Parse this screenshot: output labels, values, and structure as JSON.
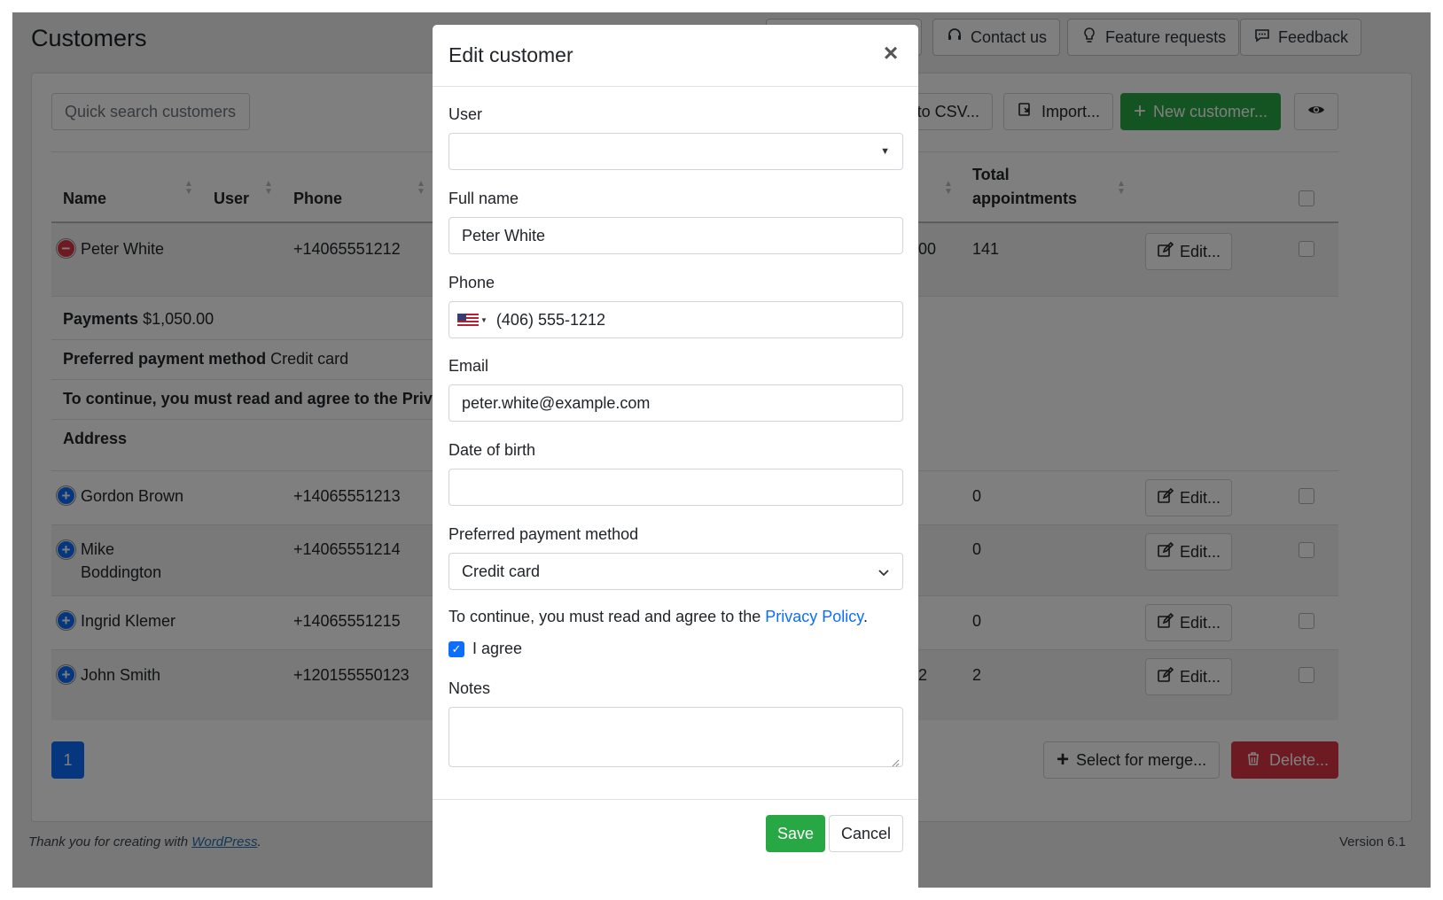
{
  "page": {
    "title": "Customers"
  },
  "top_buttons": {
    "contact": "Contact us",
    "feature": "Feature requests",
    "feedback": "Feedback"
  },
  "toolbar": {
    "search_placeholder": "Quick search customers",
    "export": "to CSV...",
    "import": "Import...",
    "new_customer": "New customer..."
  },
  "table": {
    "headers": {
      "name": "Name",
      "user": "User",
      "phone": "Phone",
      "total_line1": "Total",
      "total_line2": "appointments"
    },
    "rows": [
      {
        "name": "Peter White",
        "phone": "+14065551212",
        "partial": "00",
        "total": "141",
        "edit": "Edit...",
        "expanded": true
      },
      {
        "name": "Gordon Brown",
        "phone": "+14065551213",
        "partial": "",
        "total": "0",
        "edit": "Edit..."
      },
      {
        "name_line1": "Mike",
        "name_line2": "Boddington",
        "phone": "+14065551214",
        "partial": "",
        "total": "0",
        "edit": "Edit..."
      },
      {
        "name": "Ingrid Klemer",
        "phone": "+14065551215",
        "partial": "",
        "total": "0",
        "edit": "Edit..."
      },
      {
        "name": "John Smith",
        "phone": "+120155550123",
        "partial": "2",
        "total": "2",
        "edit": "Edit..."
      }
    ],
    "details": {
      "payments_label": "Payments",
      "payments_value": "$1,050.00",
      "method_label": "Preferred payment method",
      "method_value": "Credit card",
      "privacy_label": "To continue, you must read and agree to the Priva",
      "address_label": "Address"
    }
  },
  "pagination": {
    "current": "1"
  },
  "bottom_buttons": {
    "merge": "Select for merge...",
    "delete": "Delete..."
  },
  "footer": {
    "text": "Thank you for creating with",
    "link": "WordPress",
    "period": ".",
    "version": "Version 6.1"
  },
  "modal": {
    "title": "Edit customer",
    "close": "×",
    "fields": {
      "user_label": "User",
      "user_value": "",
      "fullname_label": "Full name",
      "fullname_value": "Peter White",
      "phone_label": "Phone",
      "phone_value": "(406) 555-1212",
      "email_label": "Email",
      "email_value": "peter.white@example.com",
      "dob_label": "Date of birth",
      "dob_value": "",
      "payment_label": "Preferred payment method",
      "payment_value": "Credit card",
      "privacy_text": "To continue, you must read and agree to the",
      "privacy_link": "Privacy Policy",
      "privacy_end": ".",
      "agree_label": "I agree",
      "agree_checked": true,
      "notes_label": "Notes",
      "notes_value": ""
    },
    "save": "Save",
    "cancel": "Cancel"
  },
  "colors": {
    "primary": "#0d6efd",
    "success": "#28a745",
    "danger": "#dc3545"
  }
}
